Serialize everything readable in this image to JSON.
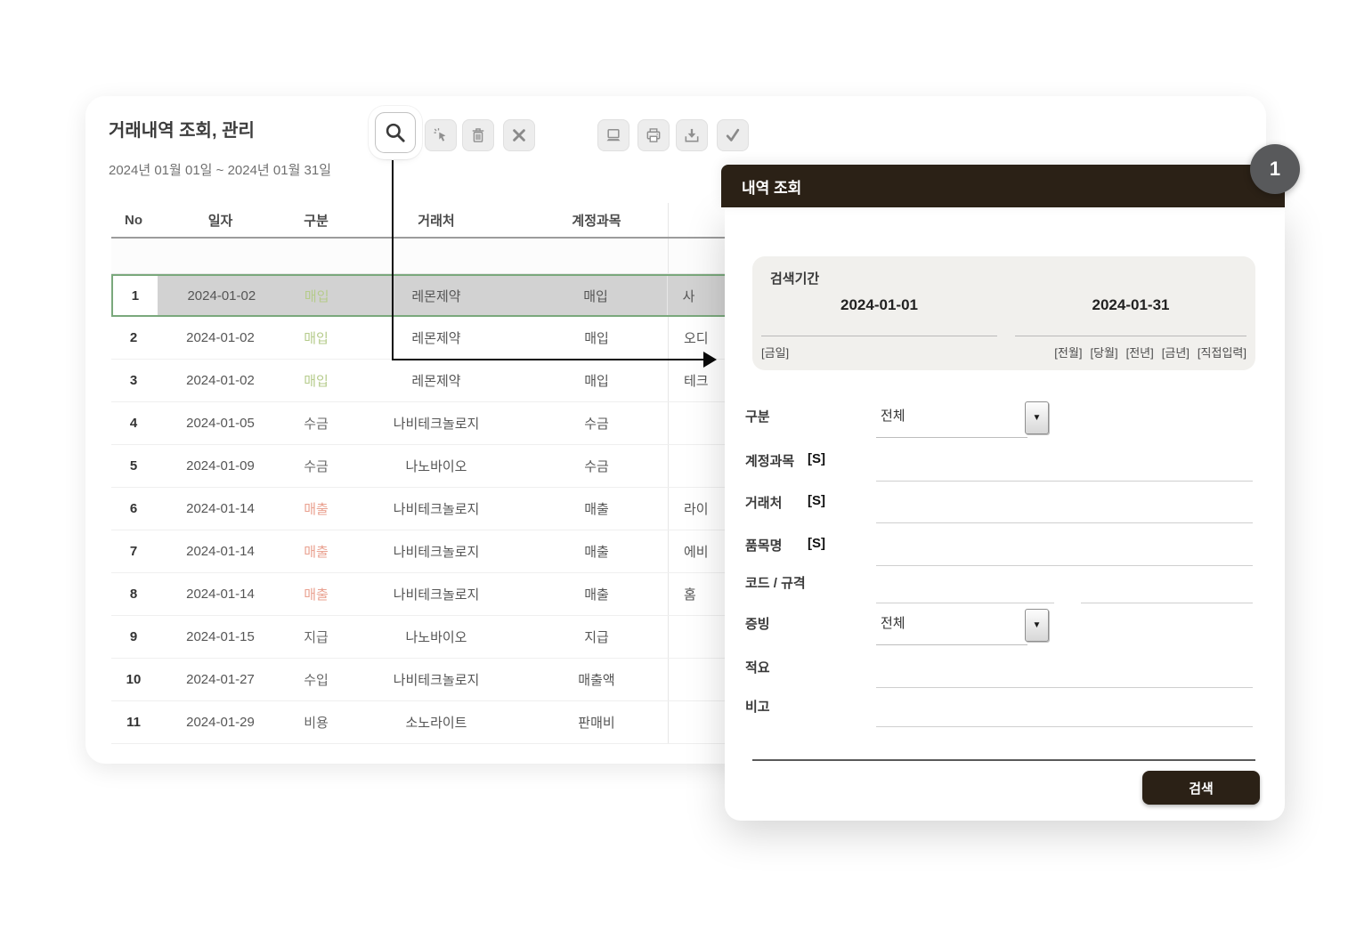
{
  "main_window": {
    "title": "거래내역 조회, 관리",
    "date_range": "2024년 01월 01일 ~ 2024년 01월 31일",
    "toolbar": {
      "buttons": [
        {
          "name": "search",
          "icon": "magnifier-icon",
          "active": true
        },
        {
          "name": "select",
          "icon": "cursor-click-icon",
          "active": false
        },
        {
          "name": "delete",
          "icon": "trash-icon",
          "active": false
        },
        {
          "name": "close",
          "icon": "x-icon",
          "active": false
        },
        {
          "name": "screen",
          "icon": "monitor-icon",
          "active": false
        },
        {
          "name": "print",
          "icon": "printer-icon",
          "active": false
        },
        {
          "name": "download",
          "icon": "download-icon",
          "active": false
        },
        {
          "name": "confirm",
          "icon": "check-icon",
          "active": false
        }
      ]
    },
    "table": {
      "columns": [
        "No",
        "일자",
        "구분",
        "거래처",
        "계정과목"
      ],
      "rows": [
        {
          "no": "1",
          "date": "2024-01-02",
          "type": "매입",
          "type_style": "green",
          "client": "레몬제약",
          "account": "매입",
          "item": "사",
          "selected": true
        },
        {
          "no": "2",
          "date": "2024-01-02",
          "type": "매입",
          "type_style": "green",
          "client": "레몬제약",
          "account": "매입",
          "item": "오디",
          "selected": false
        },
        {
          "no": "3",
          "date": "2024-01-02",
          "type": "매입",
          "type_style": "green",
          "client": "레몬제약",
          "account": "매입",
          "item": "테크",
          "selected": false
        },
        {
          "no": "4",
          "date": "2024-01-05",
          "type": "수금",
          "type_style": "plain",
          "client": "나비테크놀로지",
          "account": "수금",
          "item": "",
          "selected": false
        },
        {
          "no": "5",
          "date": "2024-01-09",
          "type": "수금",
          "type_style": "plain",
          "client": "나노바이오",
          "account": "수금",
          "item": "",
          "selected": false
        },
        {
          "no": "6",
          "date": "2024-01-14",
          "type": "매출",
          "type_style": "red",
          "client": "나비테크놀로지",
          "account": "매출",
          "item": "라이",
          "selected": false
        },
        {
          "no": "7",
          "date": "2024-01-14",
          "type": "매출",
          "type_style": "red",
          "client": "나비테크놀로지",
          "account": "매출",
          "item": "에비",
          "selected": false
        },
        {
          "no": "8",
          "date": "2024-01-14",
          "type": "매출",
          "type_style": "red",
          "client": "나비테크놀로지",
          "account": "매출",
          "item": "홈",
          "selected": false
        },
        {
          "no": "9",
          "date": "2024-01-15",
          "type": "지급",
          "type_style": "plain",
          "client": "나노바이오",
          "account": "지급",
          "item": "",
          "selected": false
        },
        {
          "no": "10",
          "date": "2024-01-27",
          "type": "수입",
          "type_style": "plain",
          "client": "나비테크놀로지",
          "account": "매출액",
          "item": "",
          "selected": false
        },
        {
          "no": "11",
          "date": "2024-01-29",
          "type": "비용",
          "type_style": "plain",
          "client": "소노라이트",
          "account": "판매비",
          "item": "",
          "selected": false
        }
      ]
    }
  },
  "popup": {
    "badge": "1",
    "title": "내역 조회",
    "period": {
      "label": "검색기간",
      "from": "2024-01-01",
      "to": "2024-01-31",
      "quick_left": "[금일]",
      "quick_right": [
        "[전월]",
        "[당월]",
        "[전년]",
        "[금년]",
        "[직접입력]"
      ]
    },
    "fields": [
      {
        "label": "구분",
        "tag": "",
        "type": "select",
        "value": "전체"
      },
      {
        "label": "계정과목",
        "tag": "[S]",
        "type": "input",
        "value": ""
      },
      {
        "label": "거래처",
        "tag": "[S]",
        "type": "input",
        "value": ""
      },
      {
        "label": "품목명",
        "tag": "[S]",
        "type": "input",
        "value": ""
      },
      {
        "label": "코드 / 규격",
        "tag": "",
        "type": "double",
        "value": ""
      },
      {
        "label": "증빙",
        "tag": "",
        "type": "select",
        "value": "전체"
      },
      {
        "label": "적요",
        "tag": "",
        "type": "input",
        "value": ""
      },
      {
        "label": "비고",
        "tag": "",
        "type": "input",
        "value": ""
      }
    ],
    "search_button": "검색"
  },
  "colors": {
    "popup_header_bg": "#2b2116",
    "type_green": "#b5cb8b",
    "type_red": "#e9a08f",
    "selected_row_border": "#7aa87c",
    "selected_row_bg": "#d2d2d2",
    "panel_bg": "#f1f0ed",
    "badge_bg": "#58595b"
  }
}
